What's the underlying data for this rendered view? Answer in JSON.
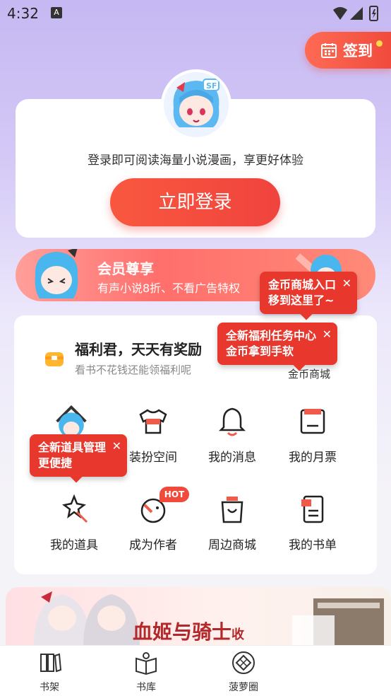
{
  "status_bar": {
    "time": "4:32",
    "notif": "A"
  },
  "checkin": {
    "label": "签到"
  },
  "login": {
    "tip": "登录即可阅读海量小说漫画，享更好体验",
    "button": "立即登录"
  },
  "vip": {
    "title": "会员尊享",
    "subtitle": "有声小说8折、不看广告特权"
  },
  "welfare": {
    "title": "福利君，天天有奖励",
    "subtitle": "看书不花钱还能领福利呢",
    "coin_mall": "金币商城"
  },
  "grid": {
    "items": [
      {
        "label": "",
        "icon": "mascot-icon"
      },
      {
        "label": "装扮空间",
        "icon": "tshirt-icon"
      },
      {
        "label": "我的消息",
        "icon": "bell-icon"
      },
      {
        "label": "我的月票",
        "icon": "ticket-icon"
      },
      {
        "label": "我的道具",
        "icon": "magic-wand-icon"
      },
      {
        "label": "成为作者",
        "icon": "author-icon"
      },
      {
        "label": "周边商城",
        "icon": "shopping-bag-icon"
      },
      {
        "label": "我的书单",
        "icon": "book-list-icon"
      }
    ],
    "hot_badge": "HOT"
  },
  "tooltips": {
    "coin_mall": [
      "金币商城入口",
      "移到这里了~"
    ],
    "task_center": [
      "全新福利任务中心",
      "金币拿到手软"
    ],
    "props": [
      "全新道具管理",
      "更便捷"
    ],
    "close": "✕"
  },
  "promo": {
    "title": "血姬与骑士",
    "suffix": "收"
  },
  "tabbar": {
    "items": [
      {
        "label": "书架",
        "icon": "bookshelf-icon"
      },
      {
        "label": "书库",
        "icon": "library-icon"
      },
      {
        "label": "菠萝圈",
        "icon": "pineapple-circle-icon"
      }
    ]
  },
  "colors": {
    "accent": "#f04a3c",
    "tooltip": "#e8382d",
    "text": "#222222"
  }
}
